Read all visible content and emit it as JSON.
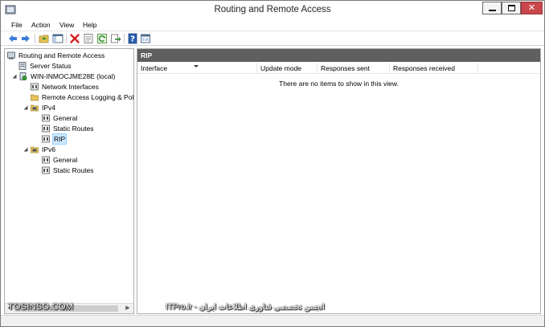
{
  "window": {
    "title": "Routing and Remote Access"
  },
  "menu": [
    "File",
    "Action",
    "View",
    "Help"
  ],
  "toolbar": {
    "buttons": [
      "back-icon",
      "forward-icon",
      "up-folder-icon",
      "show-hide-tree-icon",
      "delete-icon",
      "properties-icon",
      "refresh-icon",
      "export-list-icon",
      "help-icon",
      "mmc-view-icon"
    ]
  },
  "tree": {
    "root": "Routing and Remote Access",
    "server_status": "Server Status",
    "server": "WIN-INMOCJME28E (local)",
    "network_interfaces": "Network Interfaces",
    "remote_access_logging": "Remote Access Logging & Pol",
    "ipv4": "IPv4",
    "ipv4_general": "General",
    "ipv4_static_routes": "Static Routes",
    "ipv4_rip": "RIP",
    "ipv6": "IPv6",
    "ipv6_general": "General",
    "ipv6_static_routes": "Static Routes"
  },
  "results": {
    "header": "RIP",
    "columns": [
      "Interface",
      "Update mode",
      "Responses sent",
      "Responses received"
    ],
    "empty_message": "There are no items to show in this view."
  },
  "watermarks": {
    "left": "TOSINSO.COM",
    "center": "ITPro.ir - انجمن تخصصی فناوری اطلاعات ایران"
  },
  "colors": {
    "result_header_bg": "#5f5f5f",
    "close_button": "#c9474b",
    "selection": "#cce8ff"
  }
}
